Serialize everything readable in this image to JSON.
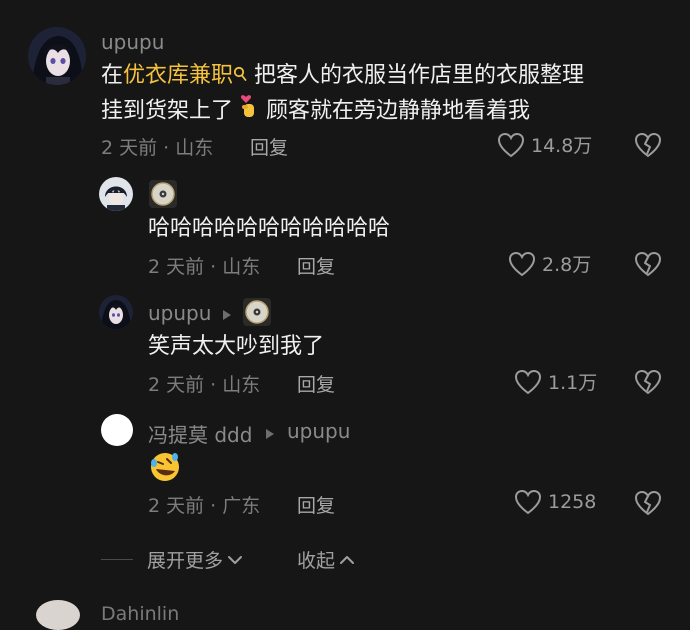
{
  "comments": [
    {
      "username": "upupu",
      "text_prefix": "在",
      "highlight": "优衣库兼职",
      "text_after_highlight": " 把客人的衣服当作店里的衣服整理",
      "text_line2_a": "挂到货架上了",
      "text_line2_b": " 顾客就在旁边静静地看着我",
      "time_location": "2 天前 · 山东",
      "reply_label": "回复",
      "likes": "14.8万"
    },
    {
      "username": "",
      "text": "哈哈哈哈哈哈哈哈哈哈哈",
      "time_location": "2 天前 · 山东",
      "reply_label": "回复",
      "likes": "2.8万"
    },
    {
      "username": "upupu",
      "text": "笑声太大吵到我了",
      "time_location": "2 天前 · 山东",
      "reply_label": "回复",
      "likes": "1.1万"
    },
    {
      "username": "冯提莫 ddd",
      "reply_to": "upupu",
      "text": "🤣",
      "time_location": "2 天前 · 广东",
      "reply_label": "回复",
      "likes": "1258"
    }
  ],
  "expand_label": "展开更多",
  "collapse_label": "收起",
  "next_comment_name": "Dahinlin",
  "icons": {
    "search": "search-icon",
    "finger_heart": "finger-heart-emoji",
    "cd": "cd-disc-icon",
    "arrow": "play-arrow-icon",
    "like": "heart-outline-icon",
    "dislike": "broken-heart-icon",
    "laugh": "rolling-laugh-emoji"
  },
  "colors": {
    "background": "#161616",
    "highlight": "#f4c23c",
    "text": "#f0f0f0",
    "muted": "#7d7d7d"
  }
}
